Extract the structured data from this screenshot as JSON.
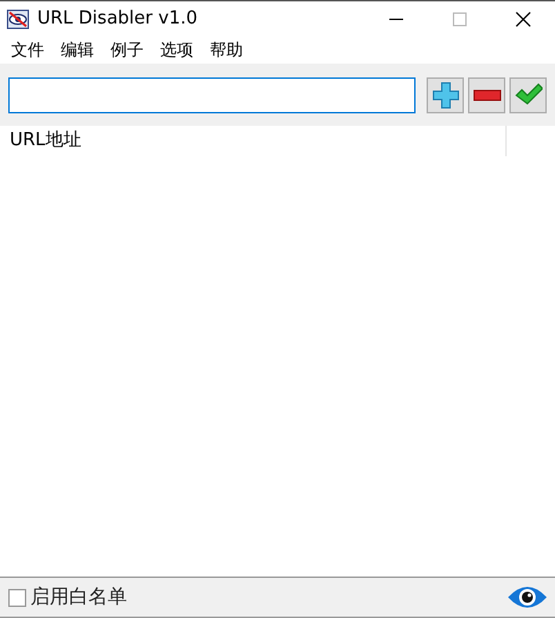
{
  "window": {
    "title": "URL Disabler v1.0"
  },
  "menu": [
    "文件",
    "编辑",
    "例子",
    "选项",
    "帮助"
  ],
  "list": {
    "columns": [
      "URL地址"
    ]
  },
  "status_bar": {
    "whitelist": {
      "label": "启用白名单",
      "checked": false
    }
  }
}
